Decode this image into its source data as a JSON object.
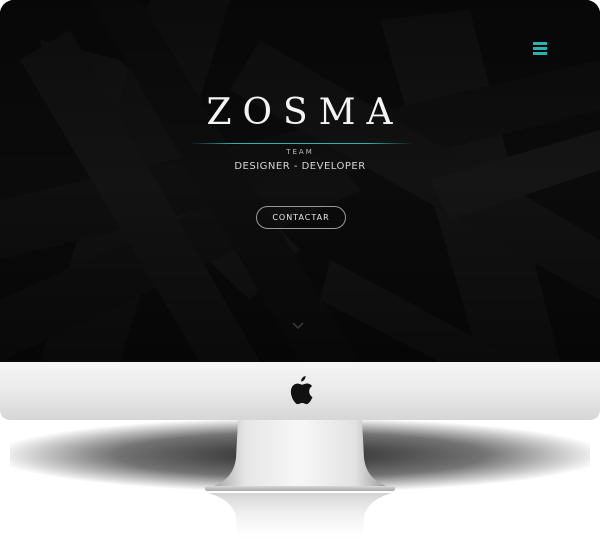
{
  "site": {
    "brand": "ZOSMA",
    "subtitle": "TEAM",
    "tagline": "DESIGNER - DEVELOPER",
    "cta_label": "CONTACTAR"
  },
  "icons": {
    "menu": "hamburger-menu-icon",
    "scroll": "chevron-down-icon",
    "computer_logo": "apple-logo-icon"
  },
  "colors": {
    "accent": "#2bb3b1",
    "background": "#0a0a0a",
    "text": "#f4f4f4",
    "chin": "#e8e8e8"
  }
}
